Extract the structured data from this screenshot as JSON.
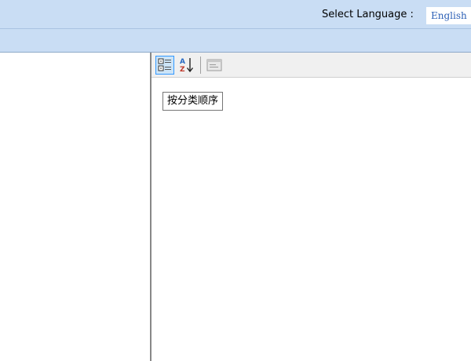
{
  "header": {
    "language_label": "Select Language :",
    "language_value": "English"
  },
  "property_toolbar": {
    "categorized_icon": "categorized-icon",
    "alphabetical_icon": "alphabetical-sort-icon",
    "property_pages_icon": "property-pages-icon",
    "tooltip": "按分类顺序"
  },
  "colors": {
    "header_bg": "#c9ddf4",
    "active_button": "#cce4f7",
    "active_border": "#3399ff",
    "language_text": "#2b5fb5"
  }
}
